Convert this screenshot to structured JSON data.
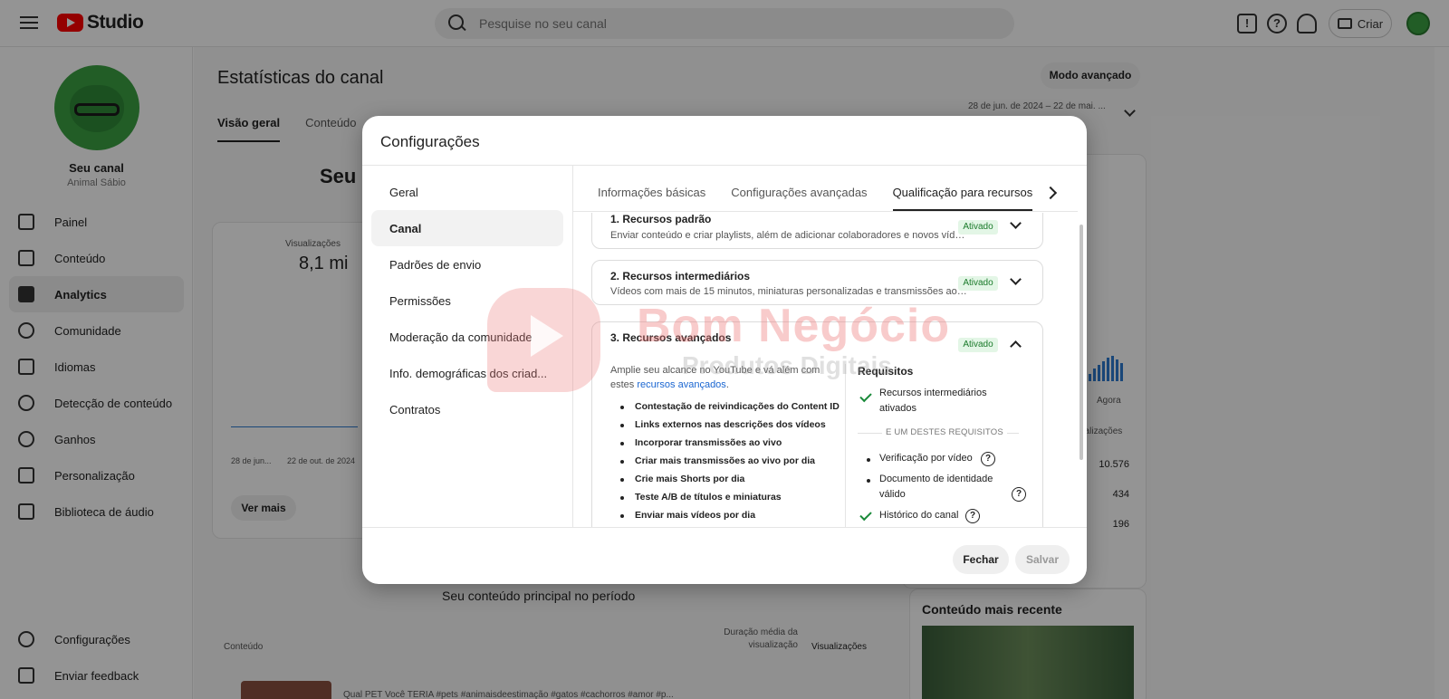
{
  "app": {
    "logo_text": "Studio"
  },
  "search": {
    "placeholder": "Pesquise no seu canal"
  },
  "topbar": {
    "create_label": "Criar"
  },
  "channel": {
    "name": "Seu canal",
    "handle": "Animal Sábio"
  },
  "sidebar": {
    "items": [
      {
        "label": "Painel",
        "icon": "dashboard-icon"
      },
      {
        "label": "Conteúdo",
        "icon": "content-icon"
      },
      {
        "label": "Analytics",
        "icon": "analytics-icon",
        "active": true
      },
      {
        "label": "Comunidade",
        "icon": "community-icon"
      },
      {
        "label": "Idiomas",
        "icon": "subtitles-icon"
      },
      {
        "label": "Detecção de conteúdo",
        "icon": "copyright-icon"
      },
      {
        "label": "Ganhos",
        "icon": "dollar-icon"
      },
      {
        "label": "Personalização",
        "icon": "magic-wand-icon"
      },
      {
        "label": "Biblioteca de áudio",
        "icon": "audio-library-icon"
      }
    ],
    "bottom": [
      {
        "label": "Configurações",
        "icon": "gear-icon"
      },
      {
        "label": "Enviar feedback",
        "icon": "feedback-icon"
      }
    ]
  },
  "main": {
    "title": "Estatísticas do canal",
    "advanced_mode": "Modo avançado",
    "date_range": "28 de jun. de 2024 – 22 de mai. ...",
    "tabs": [
      "Visão geral",
      "Conteúdo"
    ],
    "heading_fragment": "Seu",
    "views_label": "Visualizações",
    "views_value": "8,1 mi",
    "axis_start": "28 de jun...",
    "axis_mid": "22 de out. de 2024",
    "see_more": "Ver mais",
    "agora": "Agora",
    "visualizacoes_fragment": "sualizações",
    "right_values": [
      "10.576",
      "434",
      "196"
    ],
    "top_content_title": "Seu conteúdo principal no período",
    "col_content": "Conteúdo",
    "col_duration": "Duração média da visualização",
    "col_views": "Visualizações",
    "row_text": "Qual PET Você TERIA #pets #animaisdeestimação #gatos #cachorros #amor #p...",
    "recent_title": "Conteúdo mais recente"
  },
  "dialog": {
    "title": "Configurações",
    "nav": [
      "Geral",
      "Canal",
      "Padrões de envio",
      "Permissões",
      "Moderação da comunidade",
      "Info. demográficas dos criad...",
      "Contratos"
    ],
    "nav_active": 1,
    "tabs": [
      "Informações básicas",
      "Configurações avançadas",
      "Qualificação para recursos"
    ],
    "tab_active": 2,
    "panels": {
      "standard": {
        "title": "1. Recursos padrão",
        "desc": "Enviar conteúdo e criar playlists, além de adicionar colaboradores e novos vídeos",
        "status": "Ativado"
      },
      "intermediate": {
        "title": "2. Recursos intermediários",
        "desc": "Vídeos com mais de 15 minutos, miniaturas personalizadas e transmissões ao vivo",
        "status": "Ativado"
      },
      "advanced": {
        "title": "3. Recursos avançados",
        "status": "Ativado",
        "intro_prefix": "Amplie seu alcance no YouTube e vá além com estes ",
        "intro_link": "recursos avançados",
        "intro_suffix": ".",
        "features": [
          "Contestação de reivindicações do Content ID",
          "Links externos nas descrições dos vídeos",
          "Incorporar transmissões ao vivo",
          "Criar mais transmissões ao vivo por dia",
          "Crie mais Shorts por dia",
          "Teste A/B de títulos e miniaturas",
          "Enviar mais vídeos por dia"
        ],
        "requirements_title": "Requisitos",
        "req_met": "Recursos intermediários ativados",
        "or_label": "E UM DESTES REQUISITOS",
        "req_options": [
          "Verificação por vídeo",
          "Documento de identidade válido",
          "Histórico do canal"
        ]
      }
    },
    "close_label": "Fechar",
    "save_label": "Salvar"
  },
  "watermark": {
    "line1": "Bom Negócio",
    "line2": "Produtos Digitais"
  }
}
